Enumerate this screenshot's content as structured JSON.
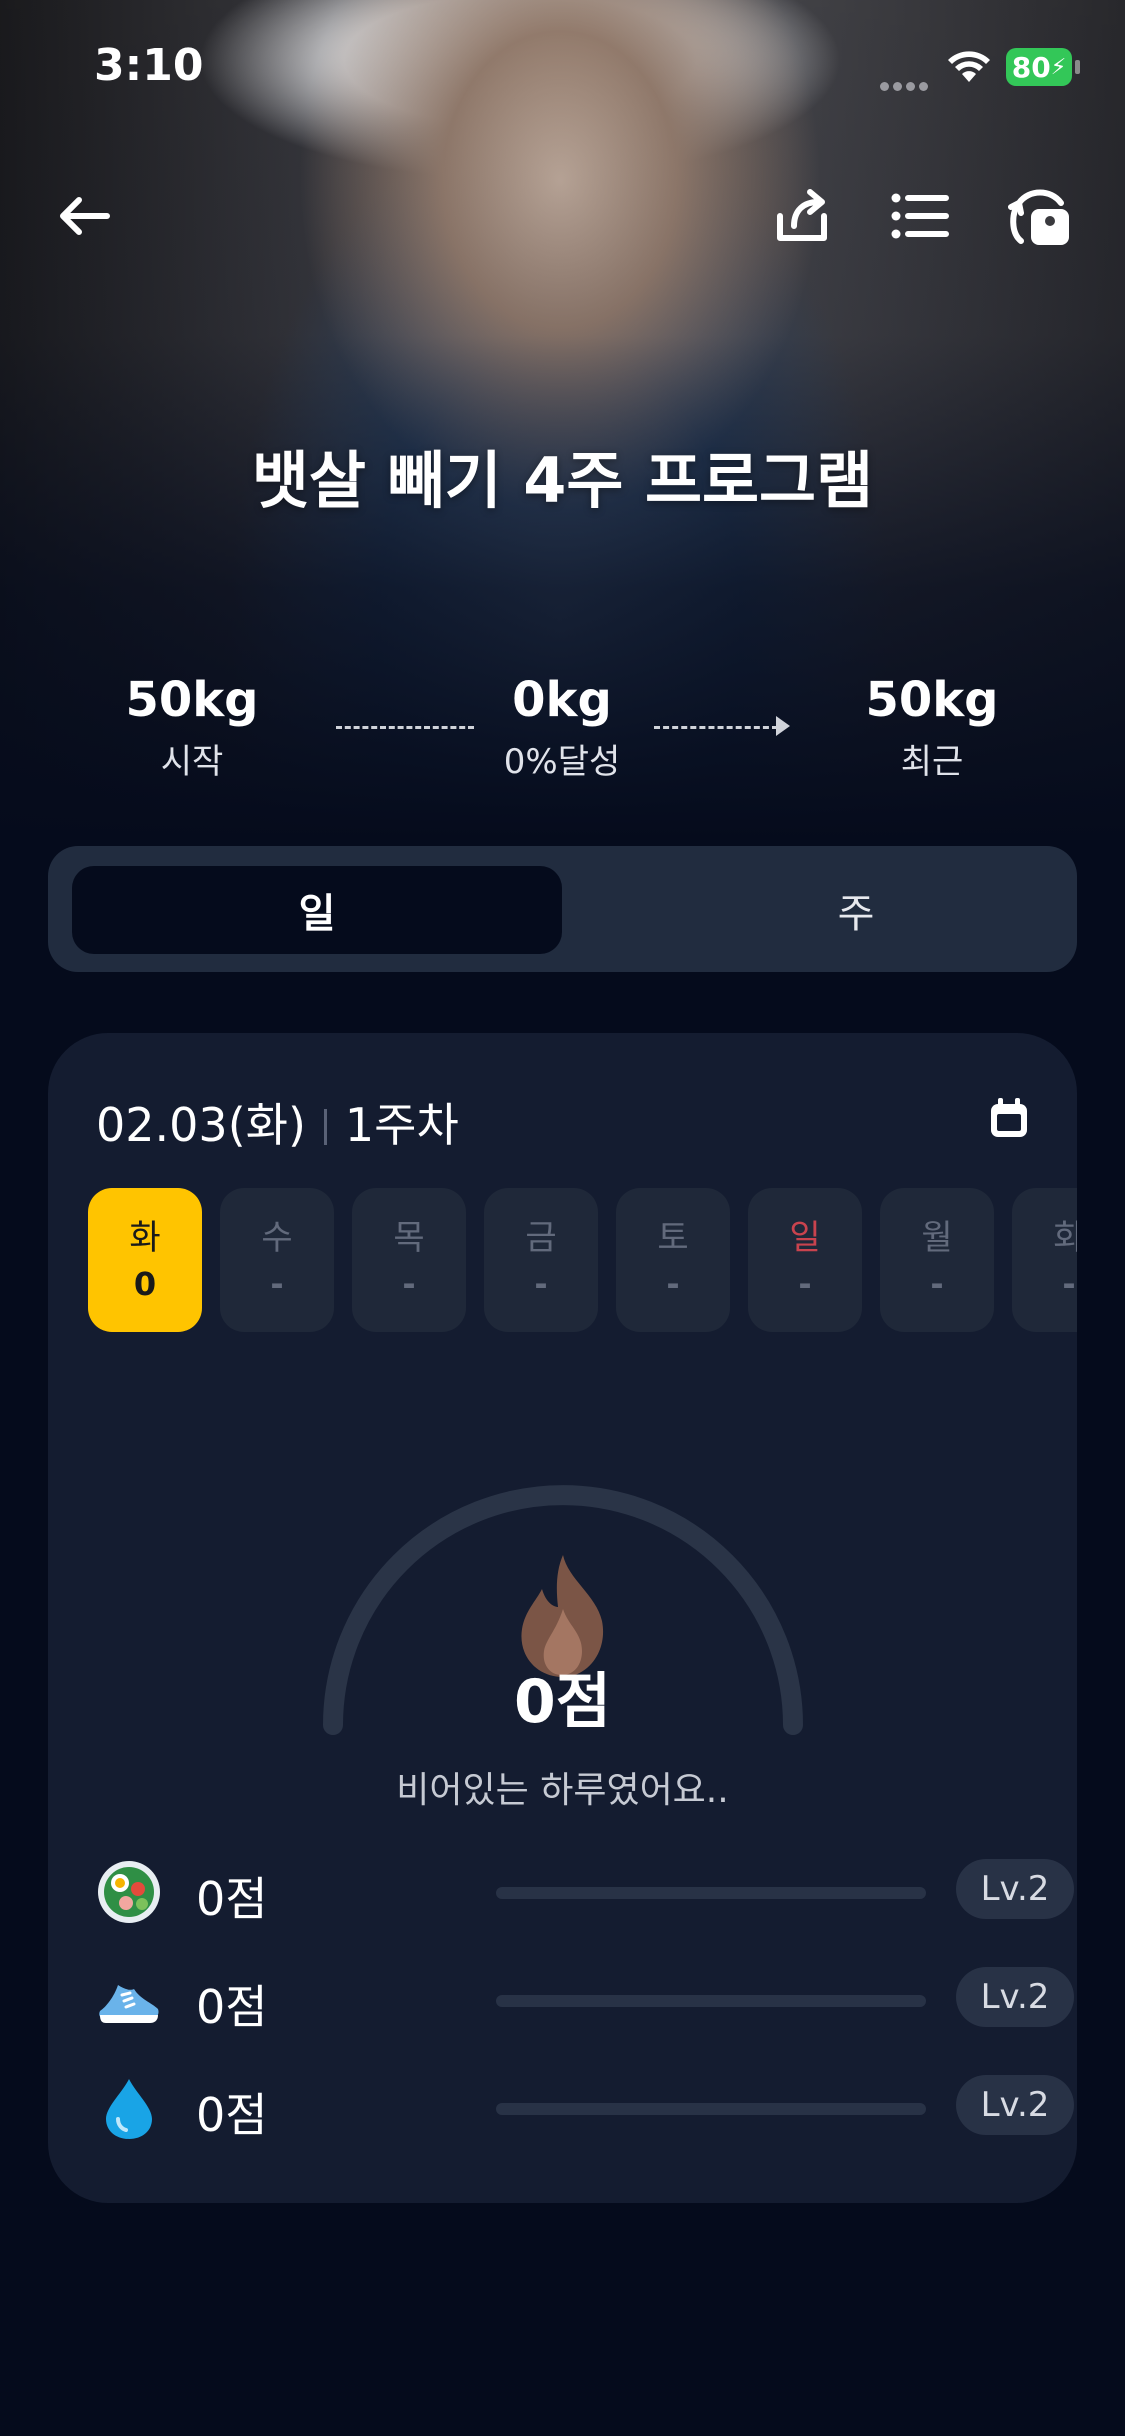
{
  "status": {
    "time": "3:10",
    "battery": "80"
  },
  "hero": {
    "title": "뱃살 빼기 4주 프로그램",
    "start": {
      "value": "50kg",
      "label": "시작"
    },
    "mid": {
      "value": "0kg",
      "label": "0%달성"
    },
    "recent": {
      "value": "50kg",
      "label": "최근"
    }
  },
  "icons": {
    "back": "arrow-left-icon",
    "share": "share-icon",
    "list": "list-icon",
    "scale": "scale-icon",
    "calendar": "calendar-icon"
  },
  "tabs": [
    {
      "label": "일",
      "active": true
    },
    {
      "label": "주",
      "active": false
    }
  ],
  "card": {
    "date": "02.03(화)",
    "week": "1주차",
    "days": [
      {
        "day": "화",
        "score": "0"
      },
      {
        "day": "수",
        "score": "-"
      },
      {
        "day": "목",
        "score": "-"
      },
      {
        "day": "금",
        "score": "-"
      },
      {
        "day": "토",
        "score": "-"
      },
      {
        "day": "일",
        "score": "-"
      },
      {
        "day": "월",
        "score": "-"
      },
      {
        "day": "화",
        "score": "-"
      }
    ],
    "score": "0점",
    "message": "비어있는 하루였어요..",
    "metrics": [
      {
        "icon": "salad-icon",
        "points": "0점",
        "level": "Lv.2",
        "progress": 0
      },
      {
        "icon": "sneaker-icon",
        "points": "0점",
        "level": "Lv.2",
        "progress": 0
      },
      {
        "icon": "water-drop-icon",
        "points": "0점",
        "level": "Lv.2",
        "progress": 0
      }
    ]
  },
  "colors": {
    "accent": "#ffc400",
    "background": "#050b1c",
    "card": "#141c30",
    "sunday": "#c9434e"
  }
}
